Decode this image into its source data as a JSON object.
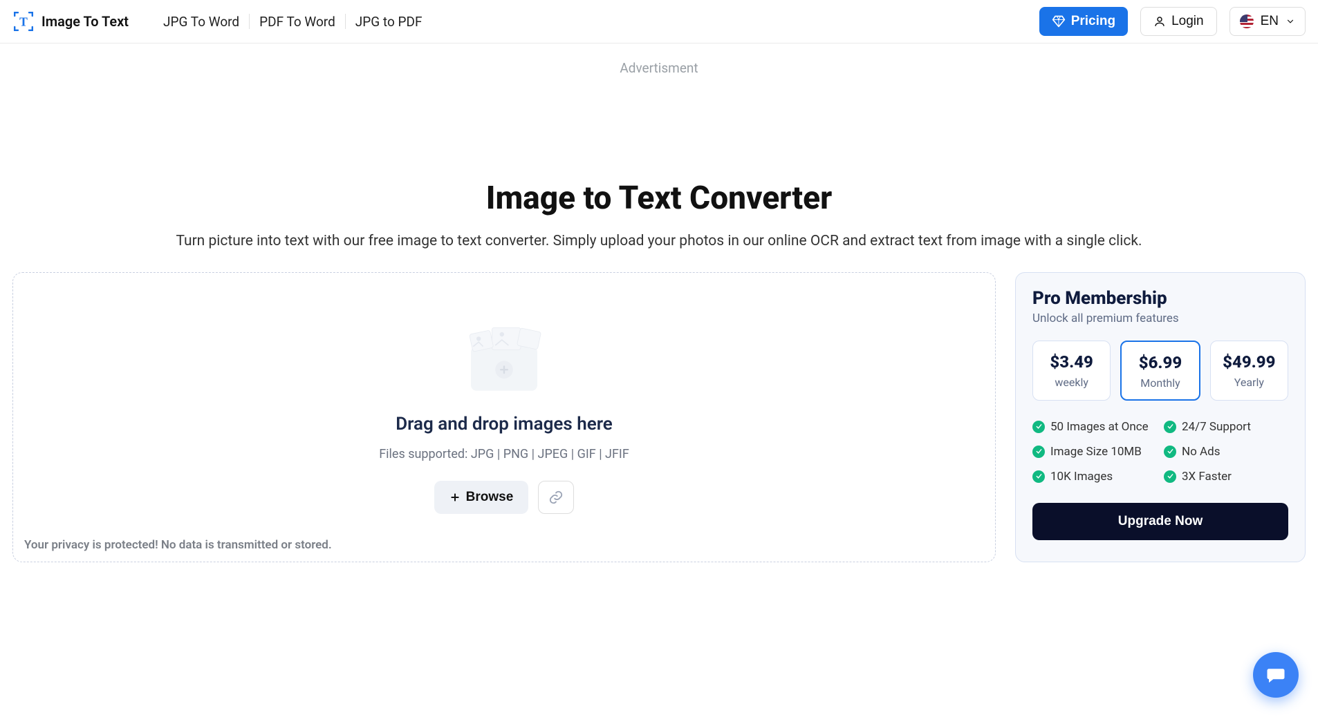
{
  "header": {
    "logo_text": "Image To Text",
    "nav": [
      "JPG To Word",
      "PDF To Word",
      "JPG to PDF"
    ],
    "pricing_label": "Pricing",
    "login_label": "Login",
    "lang_label": "EN"
  },
  "ad_label": "Advertisment",
  "hero": {
    "title": "Image to Text Converter",
    "subtitle": "Turn picture into text with our free image to text converter. Simply upload your photos in our online OCR and extract text from image with a single click."
  },
  "dropzone": {
    "title": "Drag and drop images here",
    "subtitle": "Files supported: JPG | PNG | JPEG | GIF | JFIF",
    "browse_label": "Browse",
    "privacy": "Your privacy is protected! No data is transmitted or stored."
  },
  "pro": {
    "title": "Pro Membership",
    "subtitle": "Unlock all premium features",
    "plans": [
      {
        "price": "$3.49",
        "period": "weekly",
        "selected": false
      },
      {
        "price": "$6.99",
        "period": "Monthly",
        "selected": true
      },
      {
        "price": "$49.99",
        "period": "Yearly",
        "selected": false
      }
    ],
    "features": [
      "50 Images at Once",
      "24/7 Support",
      "Image Size 10MB",
      "No Ads",
      "10K Images",
      "3X Faster"
    ],
    "upgrade_label": "Upgrade Now"
  }
}
